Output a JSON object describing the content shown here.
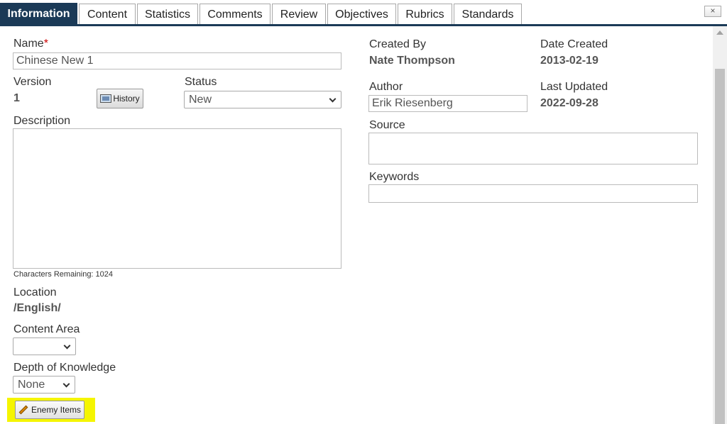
{
  "tabs": [
    {
      "label": "Information",
      "active": true
    },
    {
      "label": "Content"
    },
    {
      "label": "Statistics"
    },
    {
      "label": "Comments"
    },
    {
      "label": "Review"
    },
    {
      "label": "Objectives"
    },
    {
      "label": "Rubrics"
    },
    {
      "label": "Standards"
    }
  ],
  "close_label": "×",
  "left": {
    "name_label": "Name",
    "name_required": "*",
    "name_value": "Chinese New 1",
    "version_label": "Version",
    "version_value": "1",
    "history_label": "History",
    "status_label": "Status",
    "status_value": "New",
    "description_label": "Description",
    "chars_remaining": "Characters Remaining: 1024",
    "location_label": "Location",
    "location_value": "/English/",
    "content_area_label": "Content Area",
    "content_area_value": "",
    "dok_label": "Depth of Knowledge",
    "dok_value": "None",
    "enemy_items_label": "Enemy Items"
  },
  "right": {
    "created_by_label": "Created By",
    "created_by_value": "Nate Thompson",
    "date_created_label": "Date Created",
    "date_created_value": "2013-02-19",
    "author_label": "Author",
    "author_value": "Erik Riesenberg",
    "last_updated_label": "Last Updated",
    "last_updated_value": "2022-09-28",
    "source_label": "Source",
    "source_value": "",
    "keywords_label": "Keywords",
    "keywords_value": ""
  },
  "colors": {
    "tab_active_bg": "#1b3a57",
    "required": "#cc0000",
    "highlight": "#f5f500"
  }
}
